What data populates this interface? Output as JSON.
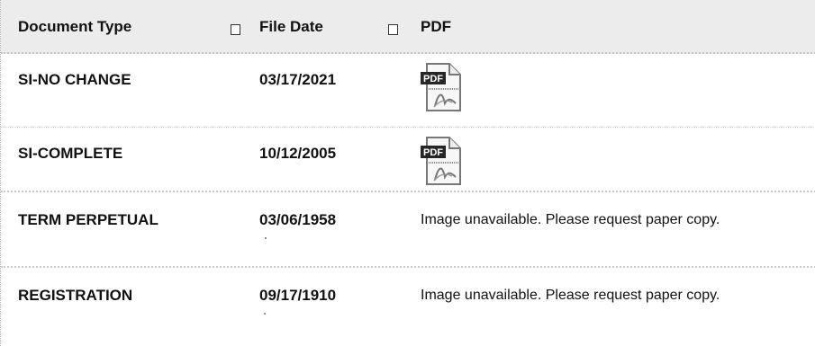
{
  "table": {
    "headers": {
      "document_type": "Document Type",
      "file_date": "File Date",
      "pdf": "PDF"
    },
    "rows": [
      {
        "document_type": "SI-NO CHANGE",
        "file_date": "03/17/2021",
        "pdf_icon": "pdf-icon"
      },
      {
        "document_type": "SI-COMPLETE",
        "file_date": "10/12/2005",
        "pdf_icon": "pdf-icon"
      },
      {
        "document_type": "TERM PERPETUAL",
        "file_date": "03/06/1958",
        "pdf_text": "Image unavailable. Please request paper copy."
      },
      {
        "document_type": "REGISTRATION",
        "file_date": "09/17/1910",
        "pdf_text": "Image unavailable. Please request paper copy."
      }
    ]
  }
}
